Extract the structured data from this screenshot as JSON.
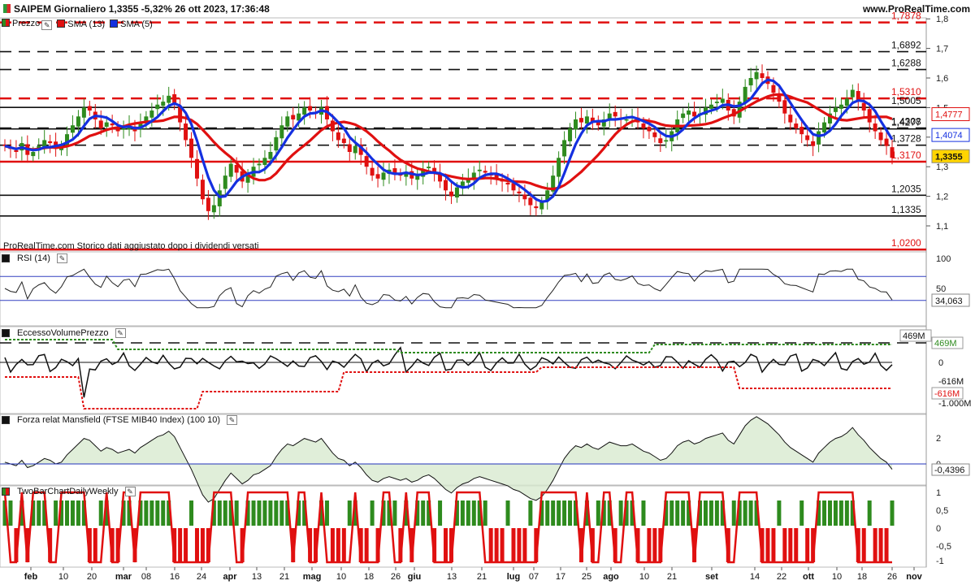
{
  "header": {
    "title": "SAIPEM Giornaliero 1,3355 -5,32% 26 ott 2023, 17:36:48",
    "site": "www.ProRealTime.com"
  },
  "legend": {
    "price": "Prezzo",
    "sma13": "SMA (13)",
    "sma5": "SMA (5)"
  },
  "note": "ProRealTime.com  Storico dati aggiustato dopo i dividendi versati",
  "panels": {
    "rsi": {
      "label": "RSI (14)",
      "value_badge": "34,063"
    },
    "volume": {
      "label": "EccessoVolumePrezzo",
      "top_badge": "469M",
      "right_green": "469M",
      "right_zero": "0",
      "right_black": "-616M",
      "right_red": "-616M",
      "right_bottom": "-1.000M"
    },
    "mansfield": {
      "label": "Forza relat Mansfield (FTSE MIB40 Index) (100 10)",
      "value_badge": "-0,4396"
    },
    "twobar": {
      "label": "TwoBarChartDailyWeekly"
    }
  },
  "colors": {
    "green": "#2e8b1e",
    "red": "#e01010",
    "blue": "#1430e0",
    "sma13": "#e01010",
    "sma5": "#1430e0",
    "current_badge": "#ffd400"
  },
  "chart_data": {
    "type": "candlestick",
    "price_axis": {
      "ticks": [
        "1,8",
        "1,7",
        "1,6",
        "1,5",
        "1,4",
        "1,3",
        "1,2",
        "1,1"
      ],
      "ylim": [
        1.08,
        1.82
      ]
    },
    "x_labels": [
      "feb",
      "10",
      "20",
      "mar",
      "08",
      "16",
      "24",
      "apr",
      "13",
      "21",
      "mag",
      "10",
      "18",
      "26",
      "giu",
      "13",
      "21",
      "lug",
      "07",
      "17",
      "25",
      "ago",
      "10",
      "21",
      "set",
      "14",
      "22",
      "ott",
      "10",
      "18",
      "26",
      "nov"
    ],
    "levels": [
      {
        "value": 1.7878,
        "label": "1,7878",
        "style": "red-dash"
      },
      {
        "value": 1.6892,
        "label": "1,6892",
        "style": "black-dash"
      },
      {
        "value": 1.6288,
        "label": "1,6288",
        "style": "black-dash"
      },
      {
        "value": 1.531,
        "label": "1,5310",
        "style": "red-dash"
      },
      {
        "value": 1.5005,
        "label": "1,5005",
        "style": "black-solid"
      },
      {
        "value": 1.4308,
        "label": "1,4308",
        "style": "black-dash"
      },
      {
        "value": 1.4277,
        "label": "1,4277",
        "style": "black-solid"
      },
      {
        "value": 1.3728,
        "label": "1,3728",
        "style": "black-dash"
      },
      {
        "value": 1.317,
        "label": "1,3170",
        "style": "red-solid"
      },
      {
        "value": 1.2035,
        "label": "1,2035",
        "style": "black-solid"
      },
      {
        "value": 1.1335,
        "label": "1,1335",
        "style": "black-solid"
      },
      {
        "value": 1.02,
        "label": "1,0200",
        "style": "red-solid"
      }
    ],
    "right_badges": [
      {
        "value": 1.4777,
        "label": "1,4777",
        "color": "red"
      },
      {
        "value": 1.4074,
        "label": "1,4074",
        "color": "blue"
      },
      {
        "value": 1.3355,
        "label": "1,3355",
        "color": "current"
      }
    ],
    "close_series": [
      1.37,
      1.36,
      1.35,
      1.38,
      1.34,
      1.35,
      1.37,
      1.39,
      1.38,
      1.36,
      1.37,
      1.41,
      1.44,
      1.47,
      1.5,
      1.49,
      1.46,
      1.43,
      1.45,
      1.44,
      1.42,
      1.43,
      1.44,
      1.42,
      1.45,
      1.47,
      1.49,
      1.51,
      1.52,
      1.54,
      1.51,
      1.45,
      1.39,
      1.33,
      1.26,
      1.19,
      1.15,
      1.17,
      1.22,
      1.27,
      1.31,
      1.28,
      1.25,
      1.27,
      1.3,
      1.31,
      1.33,
      1.35,
      1.4,
      1.44,
      1.47,
      1.46,
      1.48,
      1.5,
      1.49,
      1.48,
      1.5,
      1.46,
      1.42,
      1.39,
      1.38,
      1.35,
      1.37,
      1.34,
      1.3,
      1.27,
      1.26,
      1.28,
      1.29,
      1.28,
      1.27,
      1.28,
      1.26,
      1.27,
      1.29,
      1.3,
      1.28,
      1.25,
      1.22,
      1.2,
      1.23,
      1.25,
      1.26,
      1.28,
      1.29,
      1.28,
      1.27,
      1.26,
      1.25,
      1.24,
      1.22,
      1.21,
      1.19,
      1.17,
      1.16,
      1.18,
      1.22,
      1.27,
      1.33,
      1.39,
      1.43,
      1.46,
      1.45,
      1.47,
      1.45,
      1.44,
      1.46,
      1.48,
      1.47,
      1.46,
      1.46,
      1.47,
      1.45,
      1.43,
      1.42,
      1.4,
      1.38,
      1.39,
      1.42,
      1.46,
      1.48,
      1.49,
      1.47,
      1.48,
      1.5,
      1.51,
      1.52,
      1.53,
      1.49,
      1.47,
      1.52,
      1.57,
      1.6,
      1.62,
      1.6,
      1.58,
      1.55,
      1.52,
      1.48,
      1.45,
      1.43,
      1.41,
      1.39,
      1.37,
      1.42,
      1.45,
      1.48,
      1.5,
      1.51,
      1.53,
      1.56,
      1.52,
      1.49,
      1.45,
      1.42,
      1.39,
      1.37,
      1.33
    ]
  }
}
